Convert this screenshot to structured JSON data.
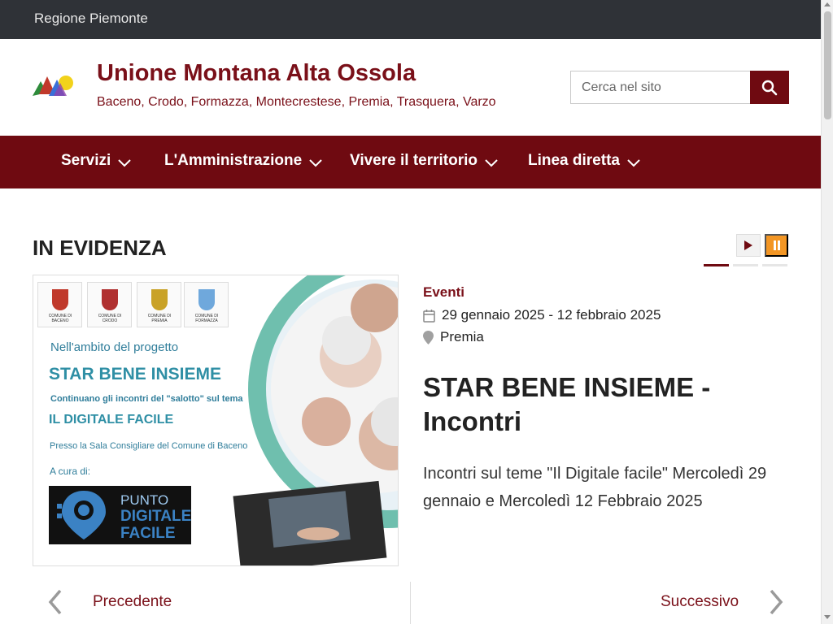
{
  "topbar": {
    "region": "Regione Piemonte"
  },
  "header": {
    "title": "Unione Montana Alta Ossola",
    "subtitle": "Baceno, Crodo, Formazza, Montecrestese, Premia, Trasquera, Varzo",
    "search_placeholder": "Cerca nel sito"
  },
  "nav": {
    "items": [
      {
        "label": "Servizi"
      },
      {
        "label": "L'Amministrazione"
      },
      {
        "label": "Vivere il territorio"
      },
      {
        "label": "Linea diretta"
      }
    ]
  },
  "highlight": {
    "title": "IN EVIDENZA",
    "slide_count": 3,
    "active_slide": 1,
    "image": {
      "crests": [
        {
          "caption": "COMUNE DI BACENO",
          "color": "#c0392b"
        },
        {
          "caption": "COMUNE DI CRODO",
          "color": "#b03030"
        },
        {
          "caption": "COMUNE DI PREMIA",
          "color": "#c9a227"
        },
        {
          "caption": "COMUNE DI FORMAZZA",
          "color": "#6fa8dc"
        }
      ],
      "intro": "Nell'ambito del progetto",
      "project": "STAR BENE INSIEME",
      "line1": "Continuano gli incontri del \"salotto\" sul tema",
      "topic": "IL DIGITALE FACILE",
      "place": "Presso la Sala Consigliare del Comune di Baceno",
      "curated": "A cura di:",
      "logo_line1": "PUNTO",
      "logo_line2": "DIGITALE",
      "logo_line3": "FACILE"
    },
    "category": "Eventi",
    "date": "29 gennaio 2025 - 12 febbraio 2025",
    "location": "Premia",
    "headline": "STAR BENE INSIEME - Incontri",
    "description": "Incontri sul teme \"Il Digitale facile\" Mercoledì 29 gennaio e Mercoledì 12 Febbraio 2025"
  },
  "pager": {
    "prev": "Precedente",
    "next": "Successivo"
  },
  "colors": {
    "brand": "#6f0a11",
    "accent": "#f39624",
    "topbar": "#2f3237"
  },
  "icons": [
    "search-icon",
    "chevron-down-icon",
    "play-icon",
    "pause-icon",
    "calendar-icon",
    "map-pin-icon",
    "chevron-left-icon",
    "chevron-right-icon"
  ]
}
